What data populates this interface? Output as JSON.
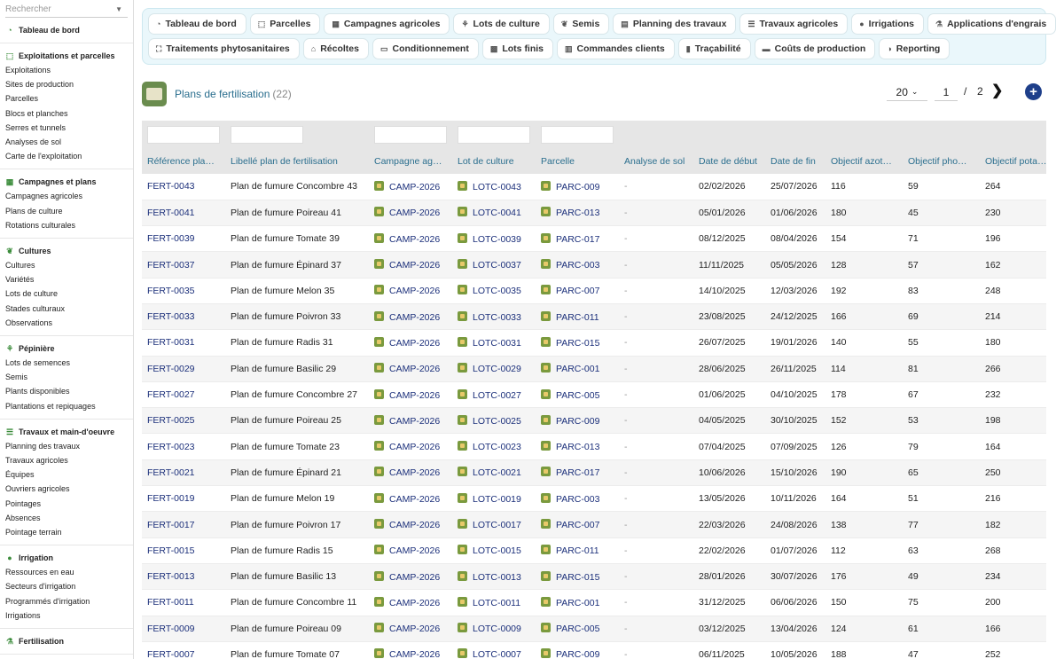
{
  "sidebar": {
    "search_placeholder": "Rechercher",
    "sections": [
      {
        "title": "Tableau de bord",
        "icon": "dashboard-icon",
        "items": []
      },
      {
        "title": "Exploitations et parcelles",
        "icon": "parcel-icon",
        "items": [
          "Exploitations",
          "Sites de production",
          "Parcelles",
          "Blocs et planches",
          "Serres et tunnels",
          "Analyses de sol",
          "Carte de l'exploitation"
        ]
      },
      {
        "title": "Campagnes et plans",
        "icon": "calendar-icon",
        "items": [
          "Campagnes agricoles",
          "Plans de culture",
          "Rotations culturales"
        ]
      },
      {
        "title": "Cultures",
        "icon": "leaf-icon",
        "items": [
          "Cultures",
          "Variétés",
          "Lots de culture",
          "Stades culturaux",
          "Observations"
        ]
      },
      {
        "title": "Pépinière",
        "icon": "sprout-icon",
        "items": [
          "Lots de semences",
          "Semis",
          "Plants disponibles",
          "Plantations et repiquages"
        ]
      },
      {
        "title": "Travaux et main-d'oeuvre",
        "icon": "list-icon",
        "items": [
          "Planning des travaux",
          "Travaux agricoles",
          "Équipes",
          "Ouvriers agricoles",
          "Pointages",
          "Absences",
          "Pointage terrain"
        ]
      },
      {
        "title": "Irrigation",
        "icon": "drop-icon",
        "items": [
          "Ressources en eau",
          "Secteurs d'irrigation",
          "Programmés d'irrigation",
          "Irrigations"
        ]
      },
      {
        "title": "Fertilisation",
        "icon": "fertilizer-icon",
        "items": []
      }
    ]
  },
  "menu": {
    "row1": [
      {
        "label": "Tableau de bord",
        "icon": "dashboard-icon"
      },
      {
        "label": "Parcelles",
        "icon": "parcel-icon"
      },
      {
        "label": "Campagnes agricoles",
        "icon": "calendar-icon"
      },
      {
        "label": "Lots de culture",
        "icon": "sprout-icon"
      },
      {
        "label": "Semis",
        "icon": "leaf-icon"
      },
      {
        "label": "Planning des travaux",
        "icon": "planning-icon"
      },
      {
        "label": "Travaux agricoles",
        "icon": "list-icon"
      },
      {
        "label": "Irrigations",
        "icon": "drop-icon"
      },
      {
        "label": "Applications d'engrais",
        "icon": "fertilizer-icon"
      }
    ],
    "row2": [
      {
        "label": "Traitements phytosanitaires",
        "icon": "spray-icon"
      },
      {
        "label": "Récoltes",
        "icon": "basket-icon"
      },
      {
        "label": "Conditionnement",
        "icon": "package-icon"
      },
      {
        "label": "Lots finis",
        "icon": "boxes-icon"
      },
      {
        "label": "Commandes clients",
        "icon": "order-icon"
      },
      {
        "label": "Traçabilité",
        "icon": "barcode-icon"
      },
      {
        "label": "Coûts de production",
        "icon": "money-icon"
      },
      {
        "label": "Reporting",
        "icon": "chart-icon"
      }
    ]
  },
  "page": {
    "title": "Plans de fertilisation",
    "count": "(22)",
    "per_page": "20",
    "current_page": "1",
    "page_sep": "/",
    "total_pages": "2"
  },
  "table": {
    "columns": [
      "Référence pla…",
      "Libellé plan de fertilisation",
      "Campagne ag…",
      "Lot de culture",
      "Parcelle",
      "Analyse de sol",
      "Date de début",
      "Date de fin",
      "Objectif azot…",
      "Objectif pho…",
      "Objectif pota…"
    ],
    "rows": [
      [
        "FERT-0043",
        "Plan de fumure Concombre 43",
        "CAMP-2026",
        "LOTC-0043",
        "PARC-009",
        "-",
        "02/02/2026",
        "25/07/2026",
        "116",
        "59",
        "264"
      ],
      [
        "FERT-0041",
        "Plan de fumure Poireau 41",
        "CAMP-2026",
        "LOTC-0041",
        "PARC-013",
        "-",
        "05/01/2026",
        "01/06/2026",
        "180",
        "45",
        "230"
      ],
      [
        "FERT-0039",
        "Plan de fumure Tomate 39",
        "CAMP-2026",
        "LOTC-0039",
        "PARC-017",
        "-",
        "08/12/2025",
        "08/04/2026",
        "154",
        "71",
        "196"
      ],
      [
        "FERT-0037",
        "Plan de fumure Épinard 37",
        "CAMP-2026",
        "LOTC-0037",
        "PARC-003",
        "-",
        "11/11/2025",
        "05/05/2026",
        "128",
        "57",
        "162"
      ],
      [
        "FERT-0035",
        "Plan de fumure Melon 35",
        "CAMP-2026",
        "LOTC-0035",
        "PARC-007",
        "-",
        "14/10/2025",
        "12/03/2026",
        "192",
        "83",
        "248"
      ],
      [
        "FERT-0033",
        "Plan de fumure Poivron 33",
        "CAMP-2026",
        "LOTC-0033",
        "PARC-011",
        "-",
        "23/08/2025",
        "24/12/2025",
        "166",
        "69",
        "214"
      ],
      [
        "FERT-0031",
        "Plan de fumure Radis 31",
        "CAMP-2026",
        "LOTC-0031",
        "PARC-015",
        "-",
        "26/07/2025",
        "19/01/2026",
        "140",
        "55",
        "180"
      ],
      [
        "FERT-0029",
        "Plan de fumure Basilic 29",
        "CAMP-2026",
        "LOTC-0029",
        "PARC-001",
        "-",
        "28/06/2025",
        "26/11/2025",
        "114",
        "81",
        "266"
      ],
      [
        "FERT-0027",
        "Plan de fumure Concombre 27",
        "CAMP-2026",
        "LOTC-0027",
        "PARC-005",
        "-",
        "01/06/2025",
        "04/10/2025",
        "178",
        "67",
        "232"
      ],
      [
        "FERT-0025",
        "Plan de fumure Poireau 25",
        "CAMP-2026",
        "LOTC-0025",
        "PARC-009",
        "-",
        "04/05/2025",
        "30/10/2025",
        "152",
        "53",
        "198"
      ],
      [
        "FERT-0023",
        "Plan de fumure Tomate 23",
        "CAMP-2026",
        "LOTC-0023",
        "PARC-013",
        "-",
        "07/04/2025",
        "07/09/2025",
        "126",
        "79",
        "164"
      ],
      [
        "FERT-0021",
        "Plan de fumure Épinard 21",
        "CAMP-2026",
        "LOTC-0021",
        "PARC-017",
        "-",
        "10/06/2026",
        "15/10/2026",
        "190",
        "65",
        "250"
      ],
      [
        "FERT-0019",
        "Plan de fumure Melon 19",
        "CAMP-2026",
        "LOTC-0019",
        "PARC-003",
        "-",
        "13/05/2026",
        "10/11/2026",
        "164",
        "51",
        "216"
      ],
      [
        "FERT-0017",
        "Plan de fumure Poivron 17",
        "CAMP-2026",
        "LOTC-0017",
        "PARC-007",
        "-",
        "22/03/2026",
        "24/08/2026",
        "138",
        "77",
        "182"
      ],
      [
        "FERT-0015",
        "Plan de fumure Radis 15",
        "CAMP-2026",
        "LOTC-0015",
        "PARC-011",
        "-",
        "22/02/2026",
        "01/07/2026",
        "112",
        "63",
        "268"
      ],
      [
        "FERT-0013",
        "Plan de fumure Basilic 13",
        "CAMP-2026",
        "LOTC-0013",
        "PARC-015",
        "-",
        "28/01/2026",
        "30/07/2026",
        "176",
        "49",
        "234"
      ],
      [
        "FERT-0011",
        "Plan de fumure Concombre 11",
        "CAMP-2026",
        "LOTC-0011",
        "PARC-001",
        "-",
        "31/12/2025",
        "06/06/2026",
        "150",
        "75",
        "200"
      ],
      [
        "FERT-0009",
        "Plan de fumure Poireau 09",
        "CAMP-2026",
        "LOTC-0009",
        "PARC-005",
        "-",
        "03/12/2025",
        "13/04/2026",
        "124",
        "61",
        "166"
      ],
      [
        "FERT-0007",
        "Plan de fumure Tomate 07",
        "CAMP-2026",
        "LOTC-0007",
        "PARC-009",
        "-",
        "06/11/2025",
        "10/05/2026",
        "188",
        "47",
        "252"
      ]
    ]
  },
  "colors": {
    "accent": "#2a6e8e",
    "link": "#1b2f7a",
    "add_button": "#1e3f8a",
    "menu_bg": "#eaf7fb"
  }
}
